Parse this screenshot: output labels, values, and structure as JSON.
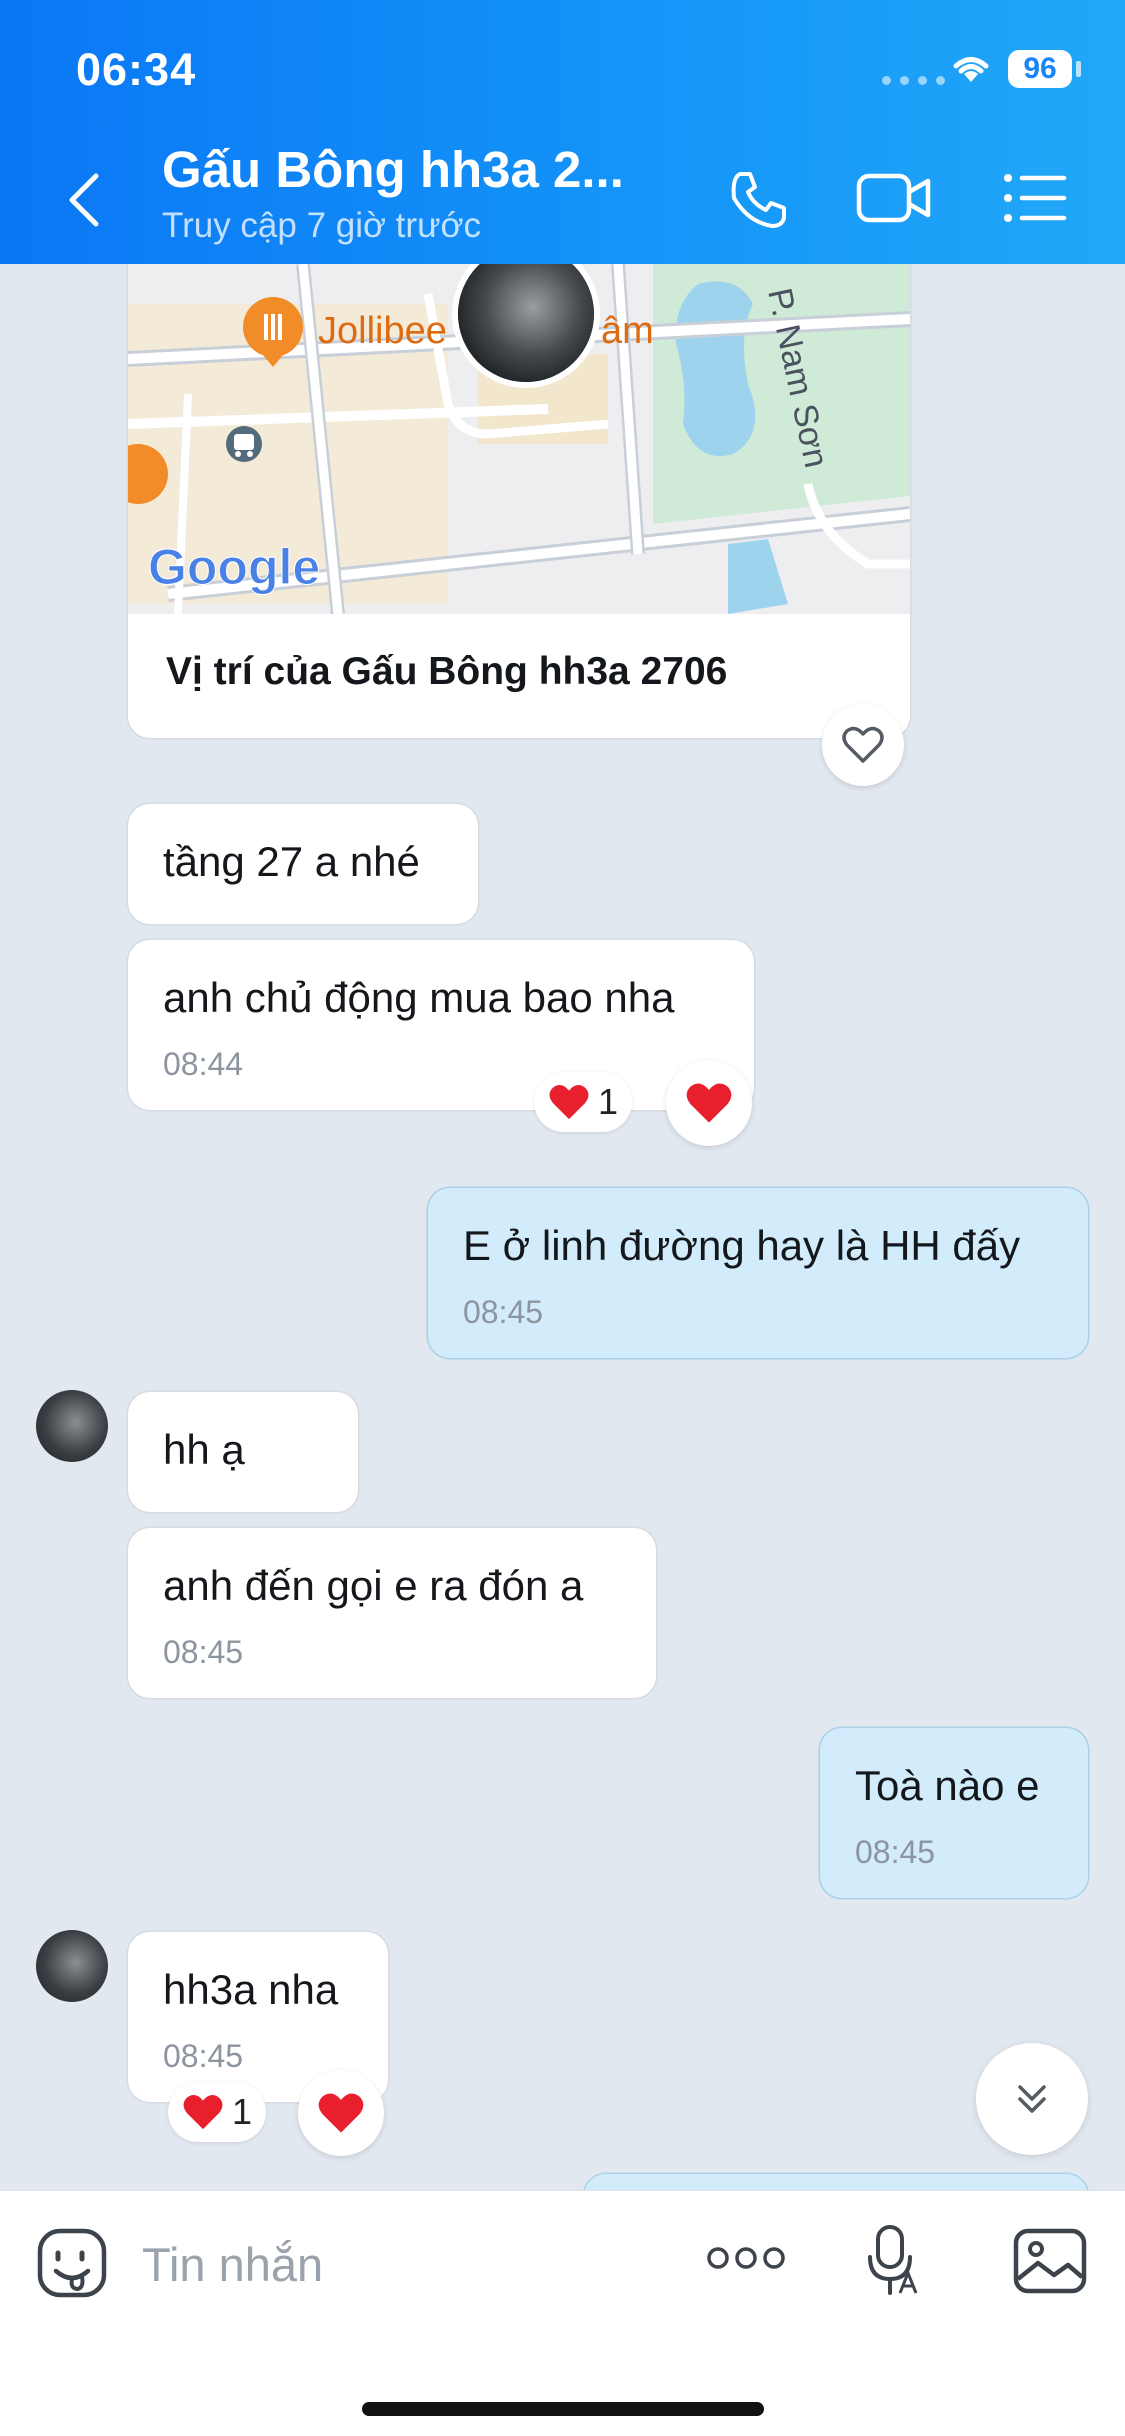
{
  "status_bar": {
    "time": "06:34",
    "battery": "96"
  },
  "header": {
    "title": "Gấu Bông hh3a 2...",
    "subtitle": "Truy cập 7 giờ trước"
  },
  "map": {
    "poi_label": "Jollibee",
    "poi_label_tail": "âm",
    "street": "P. Nam Sơn",
    "logo": "Google",
    "caption": "Vị trí của Gấu Bông hh3a 2706"
  },
  "messages": [
    {
      "id": "m1",
      "side": "received",
      "text": "tầng 27 a nhé",
      "time": ""
    },
    {
      "id": "m2",
      "side": "received",
      "text": "anh chủ động mua bao nha",
      "time": "08:44",
      "reaction_count": "1"
    },
    {
      "id": "m3",
      "side": "sent",
      "text": "E ở linh đường hay là HH đấy",
      "time": "08:45"
    },
    {
      "id": "m4",
      "side": "received",
      "text": "hh ạ",
      "time": ""
    },
    {
      "id": "m5",
      "side": "received",
      "text": "anh đến gọi e ra đón a",
      "time": "08:45"
    },
    {
      "id": "m6",
      "side": "sent",
      "text": "Toà nào e",
      "time": "08:45"
    },
    {
      "id": "m7",
      "side": "received",
      "text": "hh3a nha",
      "time": "08:45",
      "reaction_count": "1"
    }
  ],
  "input": {
    "placeholder": "Tin nhắn"
  },
  "colors": {
    "header_gradient_start": "#0a77f5",
    "header_gradient_end": "#22a8f7",
    "background": "#e2e8f0",
    "sent_bubble": "#d3ecfc",
    "received_bubble": "#ffffff",
    "heart": "#e8202d"
  },
  "icons": {
    "back": "chevron-left-icon",
    "call": "phone-icon",
    "video": "video-camera-icon",
    "menu": "list-icon",
    "like": "heart-outline-icon",
    "reaction": "heart-icon",
    "scroll_down": "double-chevron-down-icon",
    "sticker": "emoji-sticker-icon",
    "more": "more-dots-icon",
    "voice": "microphone-icon",
    "gallery": "image-icon"
  }
}
